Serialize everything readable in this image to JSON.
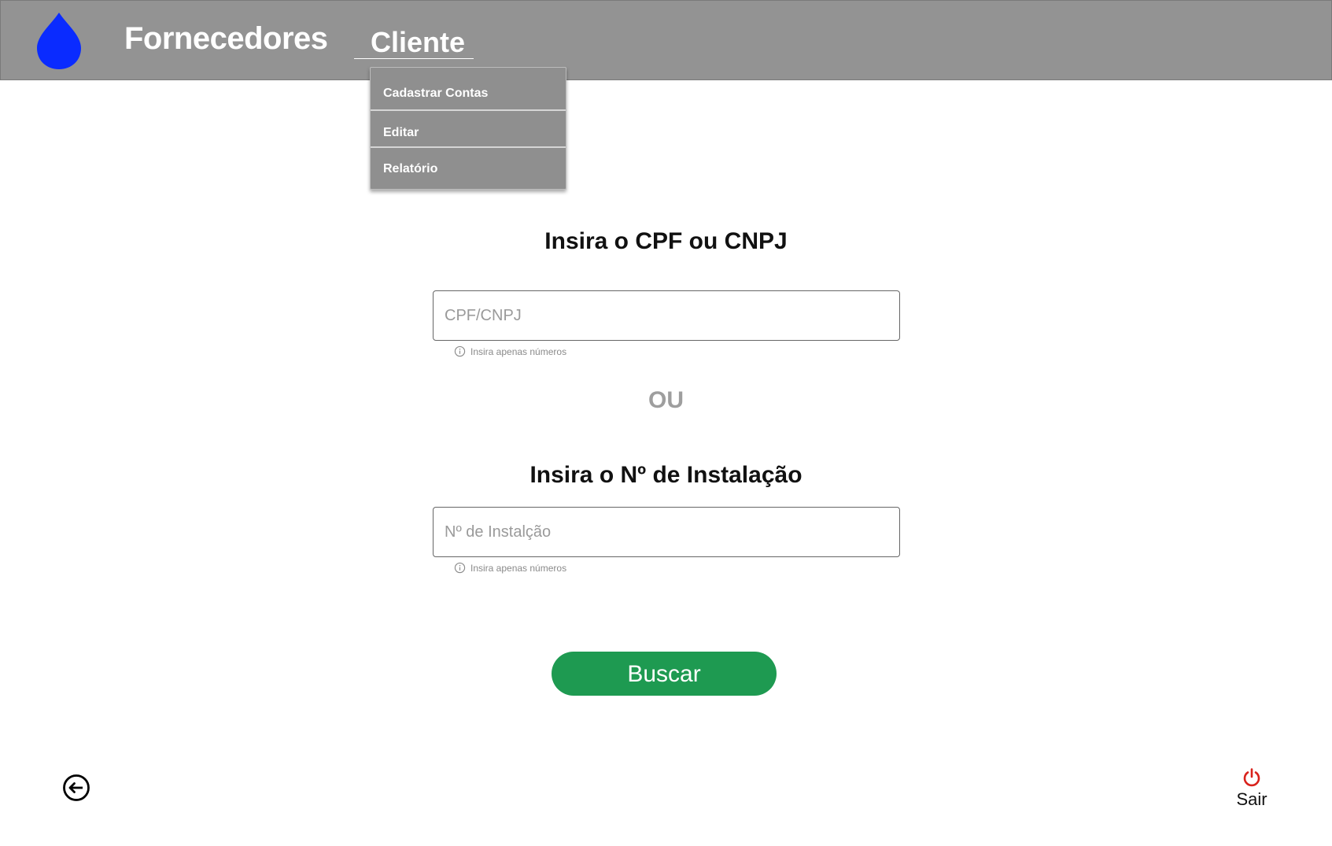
{
  "header": {
    "title": "Fornecedores",
    "menu_label": "Cliente",
    "background_color": "#939393",
    "logo_icon": "water-drop-icon",
    "logo_color": "#0a2bff"
  },
  "dropdown": {
    "items": [
      {
        "label": "Cadastrar Contas"
      },
      {
        "label": "Editar"
      },
      {
        "label": "Relatório"
      }
    ]
  },
  "form": {
    "cpf_heading": "Insira o CPF ou CNPJ",
    "cpf_placeholder": "CPF/CNPJ",
    "cpf_hint": "Insira apenas números",
    "separator": "OU",
    "installation_heading": "Insira o Nº de Instalação",
    "installation_placeholder": "Nº de Instalção",
    "installation_hint": "Insira apenas números",
    "submit_label": "Buscar",
    "submit_color": "#1e9a51"
  },
  "footer": {
    "back_icon": "back-arrow-circle-icon",
    "logout_icon": "power-icon",
    "logout_label": "Sair",
    "logout_icon_color": "#d9221c"
  }
}
